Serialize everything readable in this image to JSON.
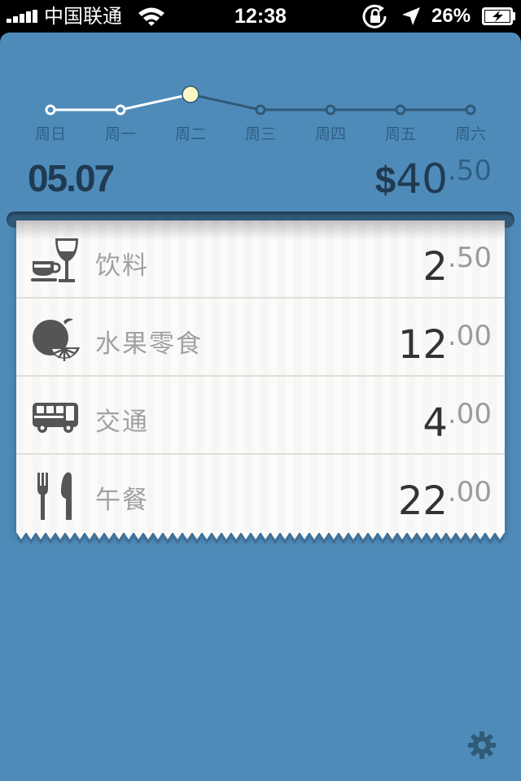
{
  "status_bar": {
    "carrier": "中国联通",
    "time": "12:38",
    "battery": "26%"
  },
  "week": {
    "days": [
      "周日",
      "周一",
      "周二",
      "周三",
      "周四",
      "周五",
      "周六"
    ],
    "selected_index": 2
  },
  "summary": {
    "date": "05.07",
    "currency": "$",
    "total_int": "40",
    "total_dec": ".50"
  },
  "receipt": {
    "items": [
      {
        "icon": "drink-icon",
        "label": "饮料",
        "amount_int": "2",
        "amount_dec": ".50"
      },
      {
        "icon": "fruit-snack-icon",
        "label": "水果零食",
        "amount_int": "12",
        "amount_dec": ".00"
      },
      {
        "icon": "bus-icon",
        "label": "交通",
        "amount_int": "4",
        "amount_dec": ".00"
      },
      {
        "icon": "cutlery-icon",
        "label": "午餐",
        "amount_int": "22",
        "amount_dec": ".00"
      }
    ]
  },
  "colors": {
    "background": "#4f8bb9",
    "dark_text": "#1f3a52",
    "selected_point": "#fdf7c6",
    "receipt": "#fbfbfa"
  }
}
